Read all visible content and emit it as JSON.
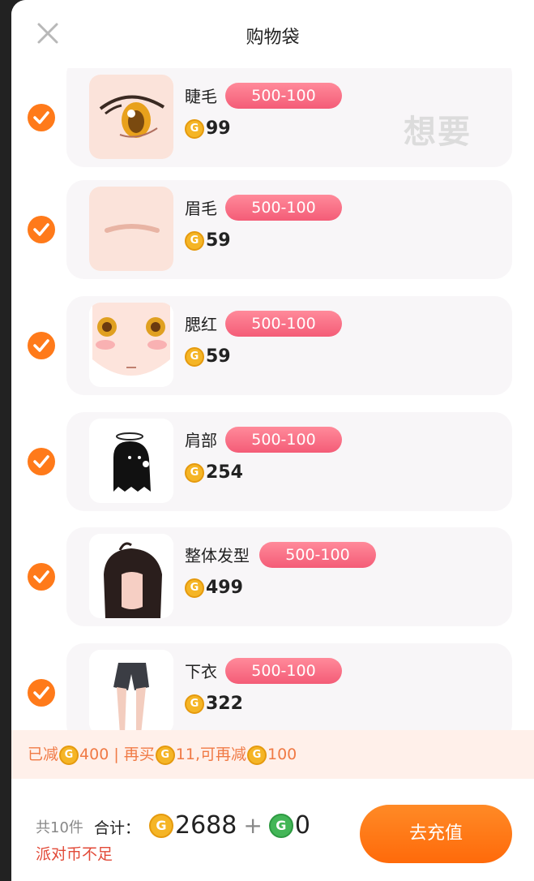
{
  "header": {
    "title": "购物袋"
  },
  "items": [
    {
      "name": "睫毛",
      "promo": "500-100",
      "price": "99"
    },
    {
      "name": "眉毛",
      "promo": "500-100",
      "price": "59"
    },
    {
      "name": "腮红",
      "promo": "500-100",
      "price": "59"
    },
    {
      "name": "肩部",
      "promo": "500-100",
      "price": "254"
    },
    {
      "name": "整体发型",
      "promo": "500-100",
      "price": "499"
    },
    {
      "name": "下衣",
      "promo": "500-100",
      "price": "322"
    }
  ],
  "watermark": "想要",
  "discount": {
    "reduced_label": "已减",
    "reduced_value": "400",
    "buy_more_label": " | 再买",
    "buy_more_value": "11",
    "again_label": ",可再减",
    "again_value": "100"
  },
  "footer": {
    "count": "共10件",
    "total_label": "合计：",
    "total_coins": "2688",
    "plus": "+",
    "green_coins": "0",
    "warning": "派对币不足",
    "recharge": "去充值"
  },
  "colors": {
    "accent": "#ff7a1a",
    "promo": "#f45c77",
    "warning": "#e24a38"
  }
}
